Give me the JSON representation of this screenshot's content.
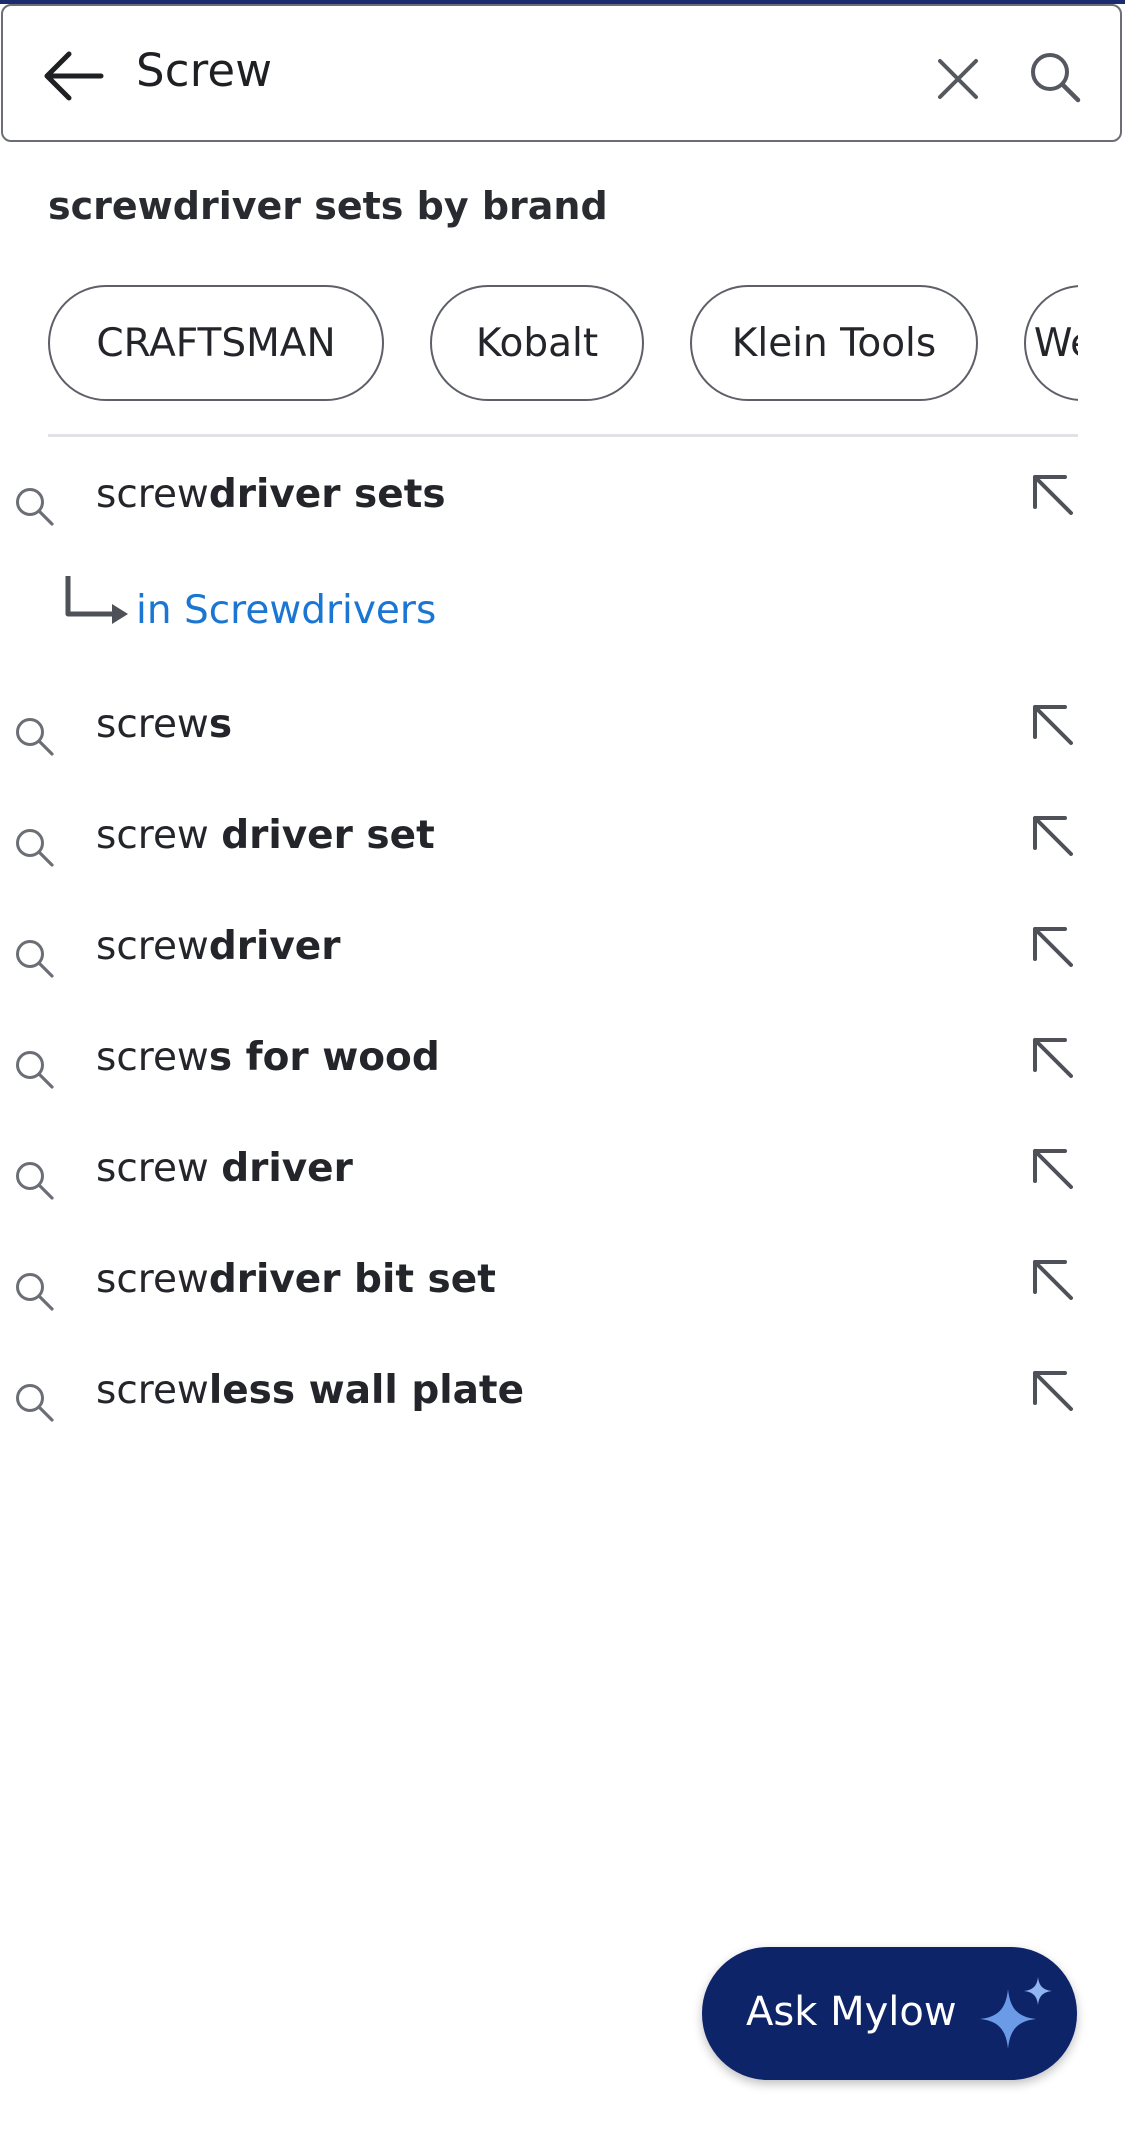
{
  "search": {
    "query": "Screw"
  },
  "brand_section": {
    "title": "screwdriver sets by brand",
    "chips": [
      "CRAFTSMAN",
      "Kobalt",
      "Klein Tools",
      "Wera"
    ]
  },
  "suggestions": [
    {
      "prefix": "screw",
      "suffix": "driver sets"
    },
    {
      "prefix": "screw",
      "suffix": "s"
    },
    {
      "prefix": "screw ",
      "suffix": "driver set"
    },
    {
      "prefix": "screw",
      "suffix": "driver"
    },
    {
      "prefix": "screw",
      "suffix": "s for wood"
    },
    {
      "prefix": "screw ",
      "suffix": "driver"
    },
    {
      "prefix": "screw",
      "suffix": "driver bit set"
    },
    {
      "prefix": "screw",
      "suffix": "less wall plate"
    }
  ],
  "category_scope": "in Screwdrivers",
  "assistant": {
    "label": "Ask Mylow"
  },
  "icons": {
    "back": "back-arrow-icon",
    "clear": "close-icon",
    "submit": "search-icon",
    "suggestion": "search-icon",
    "fill": "arrow-up-left-icon",
    "scope": "subdirectory-arrow-icon",
    "assistant": "sparkle-icon"
  },
  "colors": {
    "brand_navy": "#0e2469",
    "link_blue": "#1a76d2",
    "text": "#24252a"
  }
}
